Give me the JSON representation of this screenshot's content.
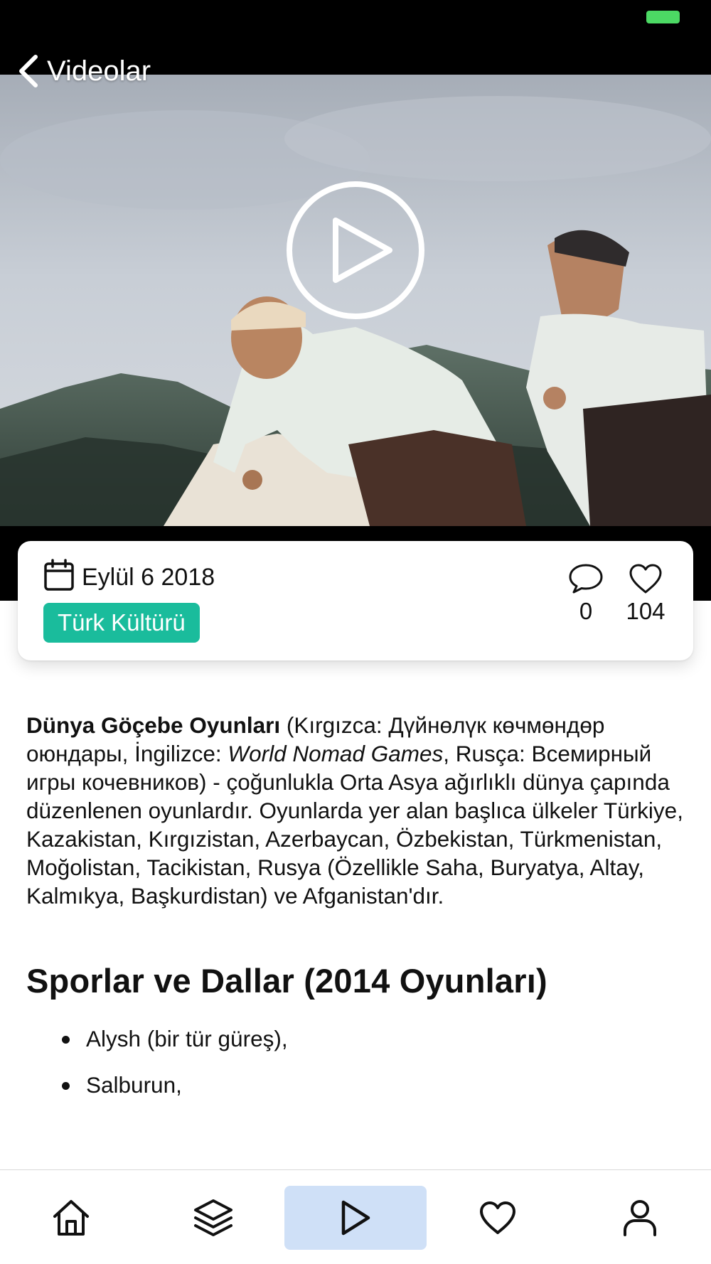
{
  "header": {
    "back_label": "Videolar"
  },
  "video": {
    "thumbnail": "two men in white shirts outdoors with mountains behind",
    "play_icon": "play-circle-icon"
  },
  "info": {
    "date": "Eylül 6 2018",
    "category": "Türk Kültürü",
    "comments_count": "0",
    "likes_count": "104"
  },
  "article": {
    "intro_bold": "Dünya Göçebe Oyunları",
    "intro_1": " (Kırgızca: Дүйнөлүк көчмөндөр оюндары, İngilizce: ",
    "intro_italic": "World Nomad Games",
    "intro_2": ", Rusça: Всемирный игры кочевников) - çoğunlukla Orta Asya ağırlıklı dünya çapında düzenlenen oyunlardır. Oyunlarda yer alan başlıca ülkeler Türkiye, Kazakistan, Kırgızistan, Azerbaycan, Özbekistan, Türkmenistan, Moğolistan, Tacikistan, Rusya (Özellikle Saha, Buryatya, Altay, Kalmıkya, Başkurdistan) ve Afganistan'dır.",
    "heading": "Sporlar ve Dallar (2014 Oyunları)",
    "sports": [
      "Alysh (bir tür güreş),",
      "Salburun,"
    ]
  },
  "tabs": [
    {
      "name": "home",
      "icon": "home-icon"
    },
    {
      "name": "categories",
      "icon": "layers-icon"
    },
    {
      "name": "videos",
      "icon": "play-icon",
      "active": true
    },
    {
      "name": "favorites",
      "icon": "heart-icon"
    },
    {
      "name": "profile",
      "icon": "user-icon"
    }
  ],
  "colors": {
    "accent_tag": "#1abc9c",
    "active_tab_bg": "#cfe0f7",
    "battery": "#4cd964"
  }
}
